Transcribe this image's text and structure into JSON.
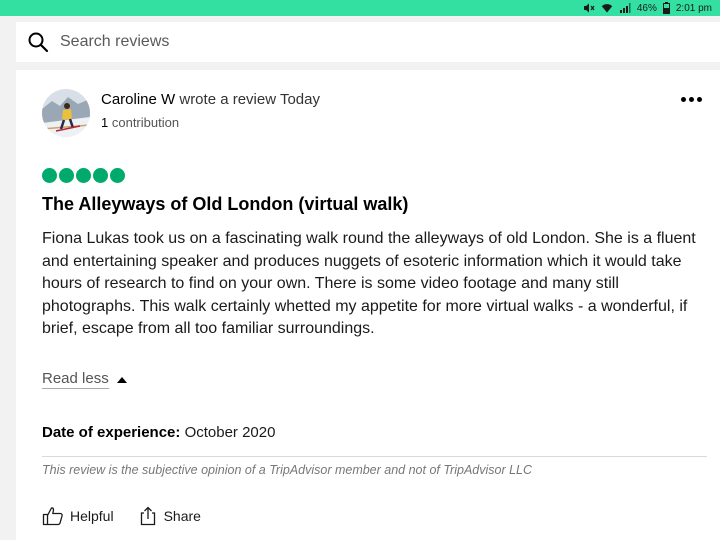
{
  "status_bar": {
    "battery": "46%",
    "time": "2:01 pm",
    "icons": [
      "mute-icon",
      "wifi-icon",
      "signal-icon",
      "battery-icon"
    ]
  },
  "search": {
    "placeholder": "Search reviews",
    "icon": "search-icon"
  },
  "review": {
    "author": "Caroline W",
    "action": "wrote a review",
    "when": "Today",
    "contribution_count": "1",
    "contribution_label": "contribution",
    "rating": 5,
    "rating_color": "#00aa6c",
    "title": "The Alleyways of Old London (virtual walk)",
    "body": "Fiona Lukas took us on a fascinating walk round the alleyways of old London. She is a fluent and entertaining speaker and produces nuggets of esoteric information which it would take hours of research to find on your own. There is some video footage and many still photographs. This walk certainly whetted my appetite for more virtual walks - a wonderful, if brief, escape from all too familiar surroundings.",
    "read_less_label": "Read less",
    "experience_label": "Date of experience:",
    "experience_value": "October 2020",
    "disclaimer": "This review is the subjective opinion of a TripAdvisor member and not of TripAdvisor LLC",
    "actions": {
      "helpful_label": "Helpful",
      "share_label": "Share"
    }
  },
  "colors": {
    "brand_green": "#34e0a1",
    "bubble_green": "#00aa6c"
  }
}
